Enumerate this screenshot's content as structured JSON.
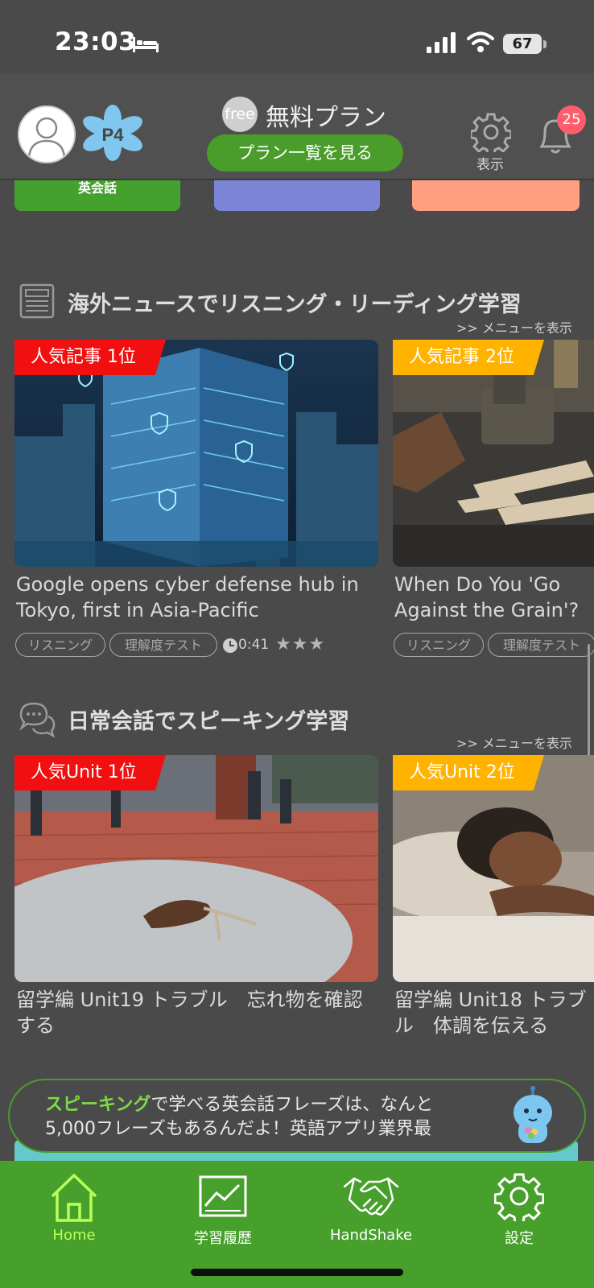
{
  "status": {
    "time": "23:03",
    "battery": "67"
  },
  "header": {
    "free_badge": "free",
    "plan_name": "無料プラン",
    "plan_button": "プラン一覧を見る",
    "display_label": "表示",
    "notification_count": "25"
  },
  "categories": [
    {
      "label": "英会話",
      "color": "#45a12e"
    },
    {
      "label": "",
      "color": "#7b84d6"
    },
    {
      "label": "",
      "color": "#ff9e80"
    }
  ],
  "news": {
    "title": "海外ニュースでリスニング・リーディング学習",
    "more": ">> メニューを表示",
    "cards": [
      {
        "rank": "人気記事 1位",
        "title": "Google opens cyber defense hub in Tokyo, first in Asia-Pacific",
        "tags": [
          "リスニング",
          "理解度テスト"
        ],
        "duration": "0:41",
        "stars": "★★★"
      },
      {
        "rank": "人気記事 2位",
        "title": "When Do You 'Go Against the Grain'?",
        "tags": [
          "リスニング",
          "理解度テスト"
        ]
      }
    ]
  },
  "speaking": {
    "title": "日常会話でスピーキング学習",
    "more": ">> メニューを表示",
    "cards": [
      {
        "rank": "人気Unit 1位",
        "title": "留学編 Unit19 トラブル　忘れ物を確認する"
      },
      {
        "rank": "人気Unit 2位",
        "title": "留学編 Unit18 トラブル　体調を伝える"
      }
    ]
  },
  "tip": {
    "highlight": "スピーキング",
    "text_rest": "で学べる英会話フレーズは、なんと",
    "line2": "5,000フレーズもあるんだよ！英語アプリ業界最"
  },
  "nav": [
    {
      "label": "Home",
      "active": true
    },
    {
      "label": "学習履歴"
    },
    {
      "label": "HandShake"
    },
    {
      "label": "設定"
    }
  ]
}
